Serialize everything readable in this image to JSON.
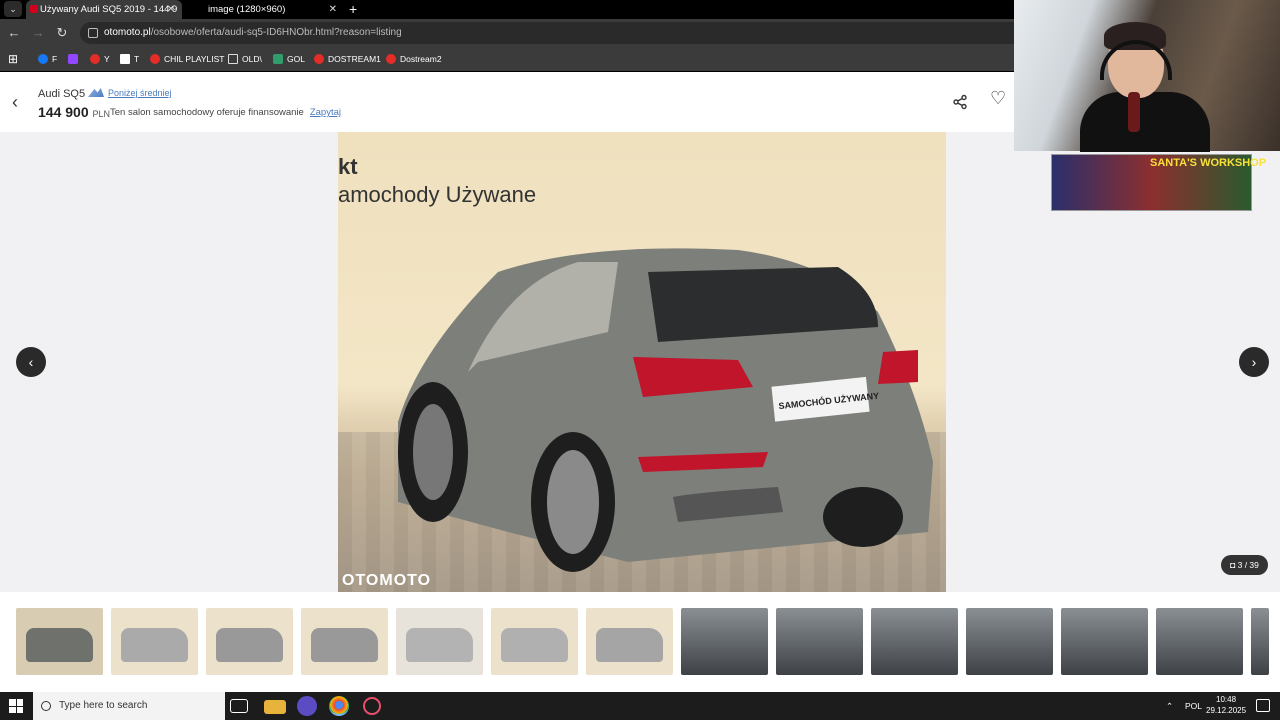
{
  "browser": {
    "tabs": [
      {
        "title": "Używany Audi SQ5 2019 - 144 9",
        "active": true
      },
      {
        "title": "image (1280×960)",
        "active": false
      }
    ],
    "url_host": "otomoto.pl",
    "url_path": "/osobowe/oferta/audi-sq5-ID6HNObr.html?reason=listing",
    "bookmarks": [
      "F",
      "Y",
      "T",
      "CHIL PLAYLIST",
      "OLD\\",
      "GOL",
      "DOSTREAM1",
      "Dostream2"
    ]
  },
  "listing": {
    "title": "Audi SQ5",
    "price_badge": "Poniżej średniej",
    "price": "144 900",
    "currency": "PLN",
    "finance_text": "Ten salon samochodowy oferuje finansowanie",
    "ask_link": "Zapytaj"
  },
  "gallery": {
    "photo_text_top": "kt",
    "photo_text": "amochody Używane",
    "plate_text": "SAMOCHÓD UŻYWANY",
    "watermark": "OTOMOTO",
    "counter": "3 / 39",
    "prev_icon": "‹",
    "next_icon": "›"
  },
  "stream_overlay": {
    "banner_text": "SANTA'S WORKSHOP"
  },
  "taskbar": {
    "search_placeholder": "Type here to search",
    "language": "POL",
    "time": "10:48",
    "date": "29.12.2025"
  },
  "colors": {
    "link": "#4a7bbf",
    "car_body": "#7d7f7a",
    "taillight": "#c0152a"
  }
}
